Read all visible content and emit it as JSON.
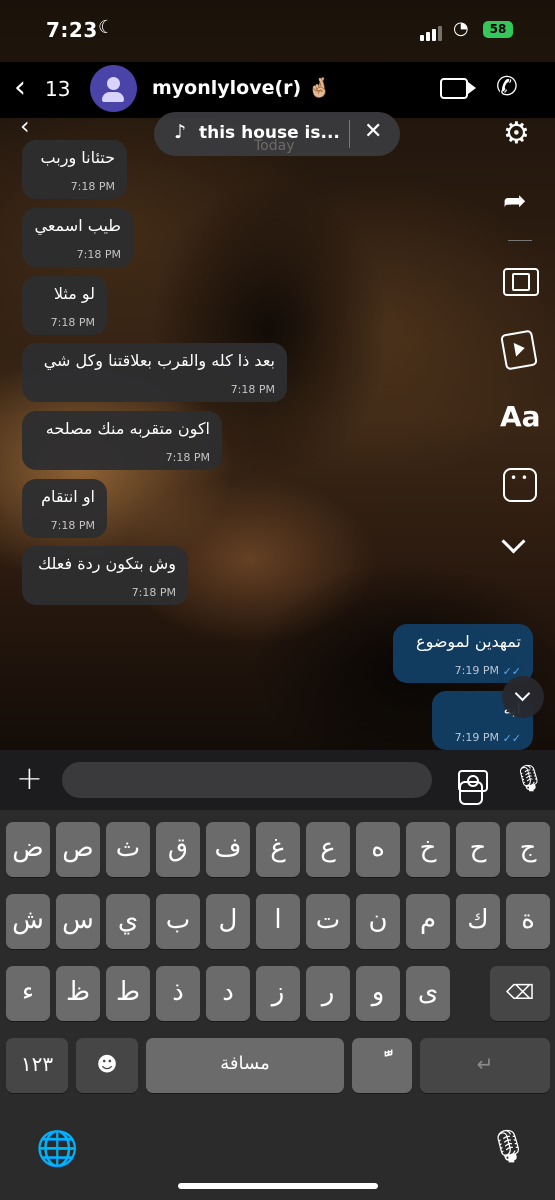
{
  "status": {
    "time": "7:23",
    "battery": "58"
  },
  "header": {
    "back_count": "13",
    "contact_name": "myonlylove(r) 🤞🏼"
  },
  "music": {
    "title": "this house is..."
  },
  "date_divider": "Today",
  "messages": [
    {
      "text": "حتئانا وربب",
      "time": "7:18 PM",
      "direction": "in"
    },
    {
      "text": "طيب اسمعي",
      "time": "7:18 PM",
      "direction": "in"
    },
    {
      "text": "لو مثلا",
      "time": "7:18 PM",
      "direction": "in"
    },
    {
      "text": "بعد ذا كله والقرب بعلاقتنا وكل شي",
      "time": "7:18 PM",
      "direction": "in"
    },
    {
      "text": "اكون متقربه منك مصلحه",
      "time": "7:18 PM",
      "direction": "in"
    },
    {
      "text": "او انتقام",
      "time": "7:18 PM",
      "direction": "in"
    },
    {
      "text": "وش بتكون ردة فعلك",
      "time": "7:18 PM",
      "direction": "in"
    },
    {
      "text": "تمهدين لموضوع",
      "time": "7:19 PM",
      "direction": "out"
    },
    {
      "text": "ايه",
      "time": "7:19 PM",
      "direction": "out"
    }
  ],
  "tools": {
    "text_tool": "Aa"
  },
  "keyboard": {
    "row1": [
      "ض",
      "ص",
      "ث",
      "ق",
      "ف",
      "غ",
      "ع",
      "ه",
      "خ",
      "ح",
      "ج"
    ],
    "row2": [
      "ش",
      "س",
      "ي",
      "ب",
      "ل",
      "ا",
      "ت",
      "ن",
      "م",
      "ك",
      "ة"
    ],
    "row3": [
      "ء",
      "ظ",
      "ط",
      "ذ",
      "د",
      "ز",
      "ر",
      "و",
      "ى"
    ],
    "numbers": "١٢٣",
    "space": "مسافة",
    "diacritic": "ًّ"
  },
  "colors": {
    "outgoing_bubble": "#123e64",
    "incoming_bubble": "#2e2e30",
    "read_ticks": "#5aa9f0"
  }
}
